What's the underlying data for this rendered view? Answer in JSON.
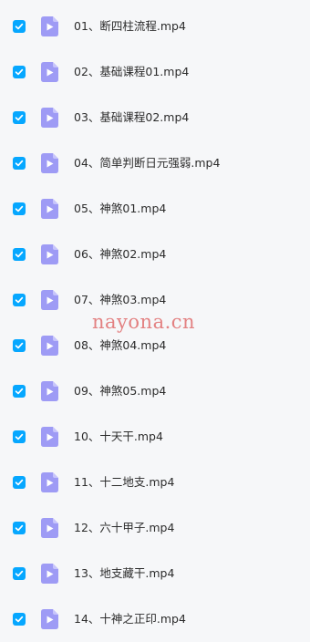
{
  "colors": {
    "checkbox": "#06a7ff",
    "video_icon": "#9e9bf5",
    "video_icon_fold": "#c7c5fb",
    "text": "#2c2c2c",
    "background": "#f6f7f9",
    "watermark": "#dc5a5a"
  },
  "file_list": {
    "items": [
      {
        "name": "01、断四柱流程.mp4",
        "checked": true,
        "icon": "video-file-icon"
      },
      {
        "name": "02、基础课程01.mp4",
        "checked": true,
        "icon": "video-file-icon"
      },
      {
        "name": "03、基础课程02.mp4",
        "checked": true,
        "icon": "video-file-icon"
      },
      {
        "name": "04、简单判断日元强弱.mp4",
        "checked": true,
        "icon": "video-file-icon"
      },
      {
        "name": "05、神煞01.mp4",
        "checked": true,
        "icon": "video-file-icon"
      },
      {
        "name": "06、神煞02.mp4",
        "checked": true,
        "icon": "video-file-icon"
      },
      {
        "name": "07、神煞03.mp4",
        "checked": true,
        "icon": "video-file-icon"
      },
      {
        "name": "08、神煞04.mp4",
        "checked": true,
        "icon": "video-file-icon"
      },
      {
        "name": "09、神煞05.mp4",
        "checked": true,
        "icon": "video-file-icon"
      },
      {
        "name": "10、十天干.mp4",
        "checked": true,
        "icon": "video-file-icon"
      },
      {
        "name": "11、十二地支.mp4",
        "checked": true,
        "icon": "video-file-icon"
      },
      {
        "name": "12、六十甲子.mp4",
        "checked": true,
        "icon": "video-file-icon"
      },
      {
        "name": "13、地支藏干.mp4",
        "checked": true,
        "icon": "video-file-icon"
      },
      {
        "name": "14、十神之正印.mp4",
        "checked": true,
        "icon": "video-file-icon"
      }
    ]
  },
  "watermark": {
    "text": "nayona.cn"
  }
}
